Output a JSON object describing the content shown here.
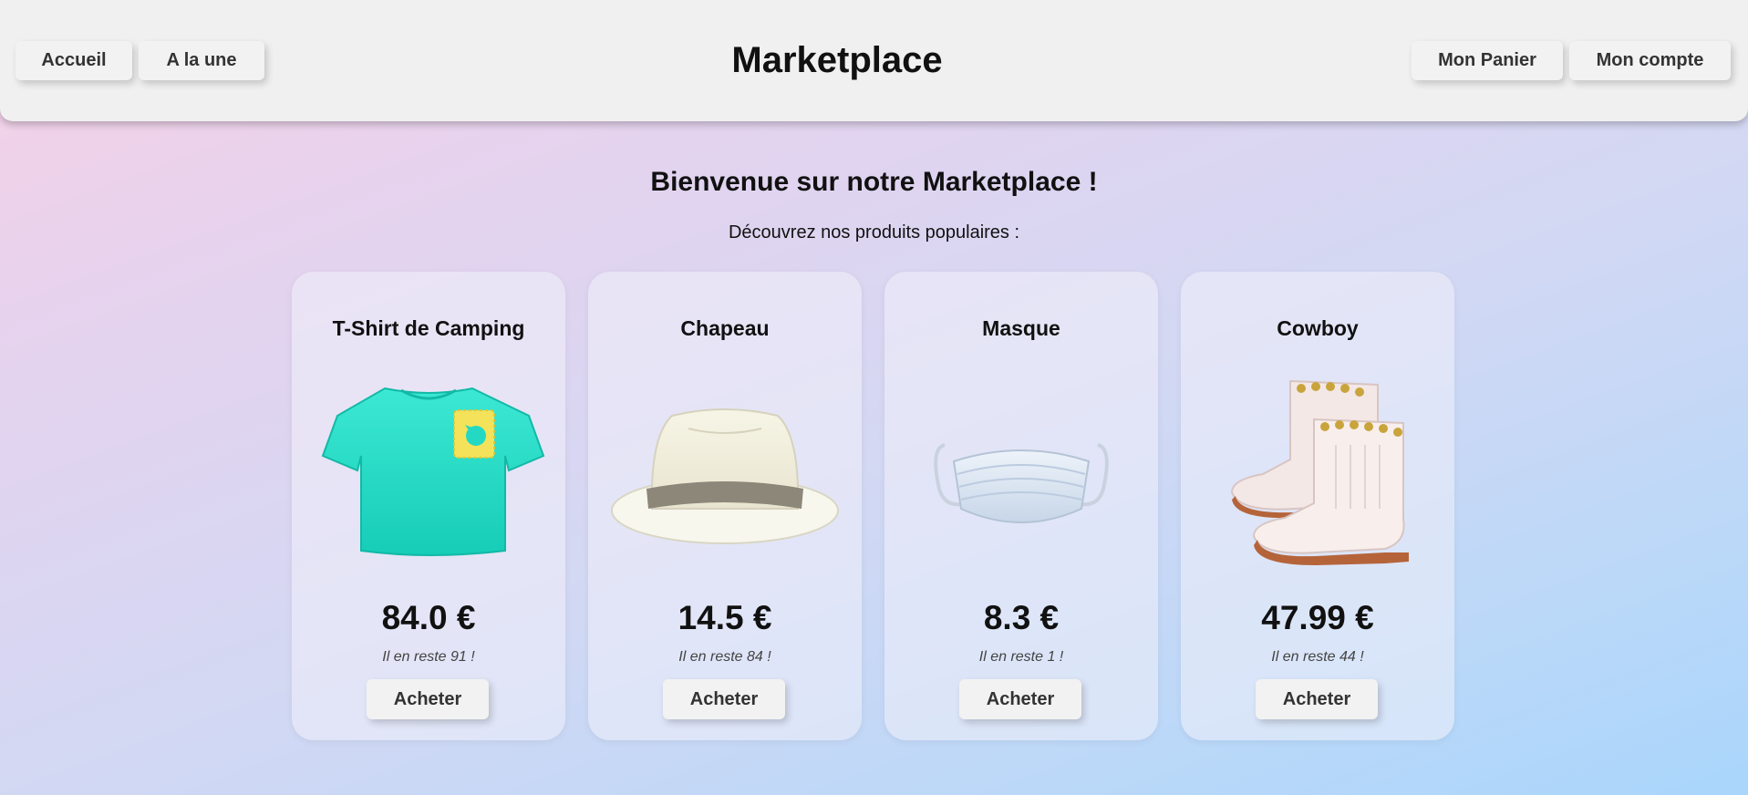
{
  "header": {
    "title": "Marketplace",
    "nav_left": [
      {
        "label": "Accueil"
      },
      {
        "label": "A la une"
      }
    ],
    "nav_right": [
      {
        "label": "Mon Panier"
      },
      {
        "label": "Mon compte"
      }
    ]
  },
  "main": {
    "welcome": "Bienvenue sur notre Marketplace !",
    "subtitle": "Découvrez nos produits populaires :"
  },
  "products": [
    {
      "name": "T-Shirt de Camping",
      "price": "84.0 €",
      "stock": "Il en reste 91 !",
      "button": "Acheter",
      "image": "tshirt-image"
    },
    {
      "name": "Chapeau",
      "price": "14.5 €",
      "stock": "Il en reste 84 !",
      "button": "Acheter",
      "image": "hat-image"
    },
    {
      "name": "Masque",
      "price": "8.3 €",
      "stock": "Il en reste 1 !",
      "button": "Acheter",
      "image": "mask-image"
    },
    {
      "name": "Cowboy",
      "price": "47.99 €",
      "stock": "Il en reste 44 !",
      "button": "Acheter",
      "image": "boots-image"
    }
  ],
  "colors": {
    "header_bg": "#f0f0f0",
    "button_bg": "#f2f2f2",
    "tshirt": "#23d9c4",
    "pocket": "#f3e25a"
  }
}
